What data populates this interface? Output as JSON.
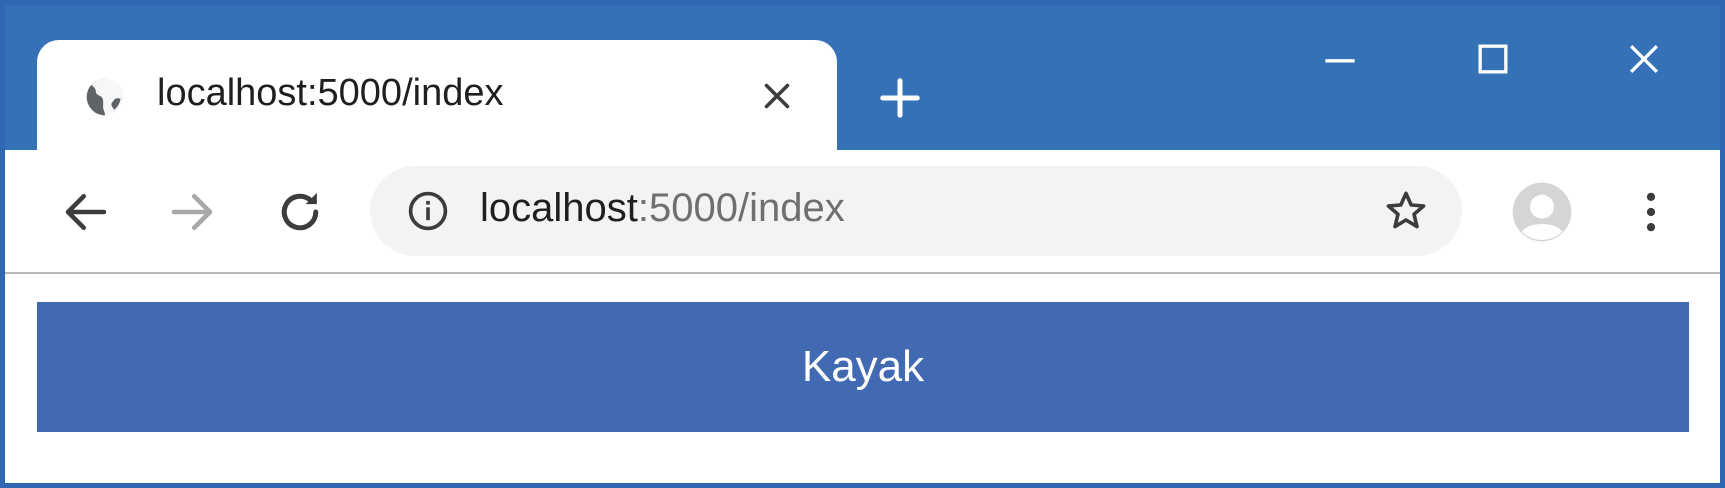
{
  "tab": {
    "title": "localhost:5000/index",
    "favicon": "globe-icon"
  },
  "window_controls": {
    "minimize": "minimize-icon",
    "maximize": "maximize-icon",
    "close": "close-icon"
  },
  "toolbar": {
    "back": "back-arrow-icon",
    "forward": "forward-arrow-icon",
    "reload": "reload-icon",
    "address": {
      "host": "localhost",
      "rest": ":5000/index"
    },
    "bookmark": "star-icon",
    "profile": "avatar-icon",
    "menu": "kebab-menu-icon"
  },
  "page": {
    "banner_text": "Kayak"
  },
  "colors": {
    "frame": "#3571b6",
    "banner": "#426ab3",
    "omnibox": "#f1f3f4"
  }
}
